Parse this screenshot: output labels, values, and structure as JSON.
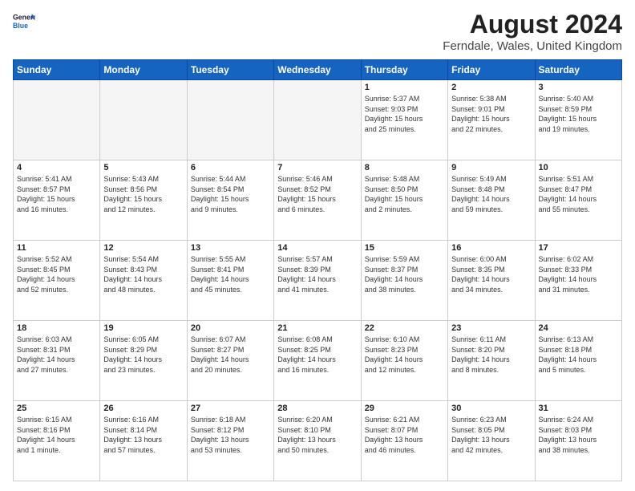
{
  "logo": {
    "line1": "General",
    "line2": "Blue"
  },
  "title": "August 2024",
  "subtitle": "Ferndale, Wales, United Kingdom",
  "headers": [
    "Sunday",
    "Monday",
    "Tuesday",
    "Wednesday",
    "Thursday",
    "Friday",
    "Saturday"
  ],
  "weeks": [
    [
      {
        "day": "",
        "info": ""
      },
      {
        "day": "",
        "info": ""
      },
      {
        "day": "",
        "info": ""
      },
      {
        "day": "",
        "info": ""
      },
      {
        "day": "1",
        "info": "Sunrise: 5:37 AM\nSunset: 9:03 PM\nDaylight: 15 hours\nand 25 minutes."
      },
      {
        "day": "2",
        "info": "Sunrise: 5:38 AM\nSunset: 9:01 PM\nDaylight: 15 hours\nand 22 minutes."
      },
      {
        "day": "3",
        "info": "Sunrise: 5:40 AM\nSunset: 8:59 PM\nDaylight: 15 hours\nand 19 minutes."
      }
    ],
    [
      {
        "day": "4",
        "info": "Sunrise: 5:41 AM\nSunset: 8:57 PM\nDaylight: 15 hours\nand 16 minutes."
      },
      {
        "day": "5",
        "info": "Sunrise: 5:43 AM\nSunset: 8:56 PM\nDaylight: 15 hours\nand 12 minutes."
      },
      {
        "day": "6",
        "info": "Sunrise: 5:44 AM\nSunset: 8:54 PM\nDaylight: 15 hours\nand 9 minutes."
      },
      {
        "day": "7",
        "info": "Sunrise: 5:46 AM\nSunset: 8:52 PM\nDaylight: 15 hours\nand 6 minutes."
      },
      {
        "day": "8",
        "info": "Sunrise: 5:48 AM\nSunset: 8:50 PM\nDaylight: 15 hours\nand 2 minutes."
      },
      {
        "day": "9",
        "info": "Sunrise: 5:49 AM\nSunset: 8:48 PM\nDaylight: 14 hours\nand 59 minutes."
      },
      {
        "day": "10",
        "info": "Sunrise: 5:51 AM\nSunset: 8:47 PM\nDaylight: 14 hours\nand 55 minutes."
      }
    ],
    [
      {
        "day": "11",
        "info": "Sunrise: 5:52 AM\nSunset: 8:45 PM\nDaylight: 14 hours\nand 52 minutes."
      },
      {
        "day": "12",
        "info": "Sunrise: 5:54 AM\nSunset: 8:43 PM\nDaylight: 14 hours\nand 48 minutes."
      },
      {
        "day": "13",
        "info": "Sunrise: 5:55 AM\nSunset: 8:41 PM\nDaylight: 14 hours\nand 45 minutes."
      },
      {
        "day": "14",
        "info": "Sunrise: 5:57 AM\nSunset: 8:39 PM\nDaylight: 14 hours\nand 41 minutes."
      },
      {
        "day": "15",
        "info": "Sunrise: 5:59 AM\nSunset: 8:37 PM\nDaylight: 14 hours\nand 38 minutes."
      },
      {
        "day": "16",
        "info": "Sunrise: 6:00 AM\nSunset: 8:35 PM\nDaylight: 14 hours\nand 34 minutes."
      },
      {
        "day": "17",
        "info": "Sunrise: 6:02 AM\nSunset: 8:33 PM\nDaylight: 14 hours\nand 31 minutes."
      }
    ],
    [
      {
        "day": "18",
        "info": "Sunrise: 6:03 AM\nSunset: 8:31 PM\nDaylight: 14 hours\nand 27 minutes."
      },
      {
        "day": "19",
        "info": "Sunrise: 6:05 AM\nSunset: 8:29 PM\nDaylight: 14 hours\nand 23 minutes."
      },
      {
        "day": "20",
        "info": "Sunrise: 6:07 AM\nSunset: 8:27 PM\nDaylight: 14 hours\nand 20 minutes."
      },
      {
        "day": "21",
        "info": "Sunrise: 6:08 AM\nSunset: 8:25 PM\nDaylight: 14 hours\nand 16 minutes."
      },
      {
        "day": "22",
        "info": "Sunrise: 6:10 AM\nSunset: 8:23 PM\nDaylight: 14 hours\nand 12 minutes."
      },
      {
        "day": "23",
        "info": "Sunrise: 6:11 AM\nSunset: 8:20 PM\nDaylight: 14 hours\nand 8 minutes."
      },
      {
        "day": "24",
        "info": "Sunrise: 6:13 AM\nSunset: 8:18 PM\nDaylight: 14 hours\nand 5 minutes."
      }
    ],
    [
      {
        "day": "25",
        "info": "Sunrise: 6:15 AM\nSunset: 8:16 PM\nDaylight: 14 hours\nand 1 minute."
      },
      {
        "day": "26",
        "info": "Sunrise: 6:16 AM\nSunset: 8:14 PM\nDaylight: 13 hours\nand 57 minutes."
      },
      {
        "day": "27",
        "info": "Sunrise: 6:18 AM\nSunset: 8:12 PM\nDaylight: 13 hours\nand 53 minutes."
      },
      {
        "day": "28",
        "info": "Sunrise: 6:20 AM\nSunset: 8:10 PM\nDaylight: 13 hours\nand 50 minutes."
      },
      {
        "day": "29",
        "info": "Sunrise: 6:21 AM\nSunset: 8:07 PM\nDaylight: 13 hours\nand 46 minutes."
      },
      {
        "day": "30",
        "info": "Sunrise: 6:23 AM\nSunset: 8:05 PM\nDaylight: 13 hours\nand 42 minutes."
      },
      {
        "day": "31",
        "info": "Sunrise: 6:24 AM\nSunset: 8:03 PM\nDaylight: 13 hours\nand 38 minutes."
      }
    ]
  ]
}
